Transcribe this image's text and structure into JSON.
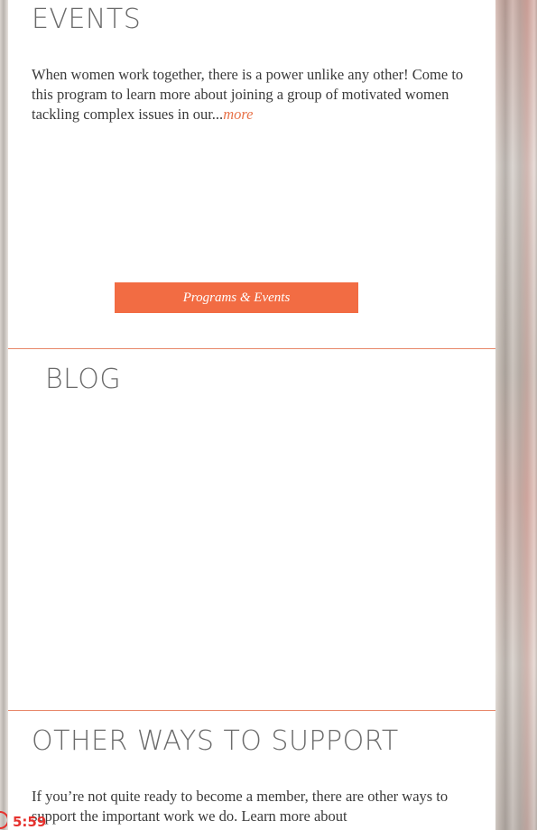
{
  "events": {
    "title": "EVENTS",
    "description": "When women work together, there is a power unlike any other! Come to this program to learn more about joining a group of motivated women tackling complex issues in our...",
    "more_label": "more",
    "button_label": "Programs & Events"
  },
  "blog": {
    "title": "BLOG"
  },
  "support": {
    "title": "OTHER WAYS TO SUPPORT",
    "description": "If you’re not quite ready to become a member, there are other ways to support the important work we do. Learn more about"
  },
  "timer": {
    "value": "5:59",
    "icon": "timer-icon"
  },
  "colors": {
    "accent": "#f26c43",
    "divider": "#e8876a",
    "heading": "#6b6b6b",
    "timer": "#e6322e"
  }
}
